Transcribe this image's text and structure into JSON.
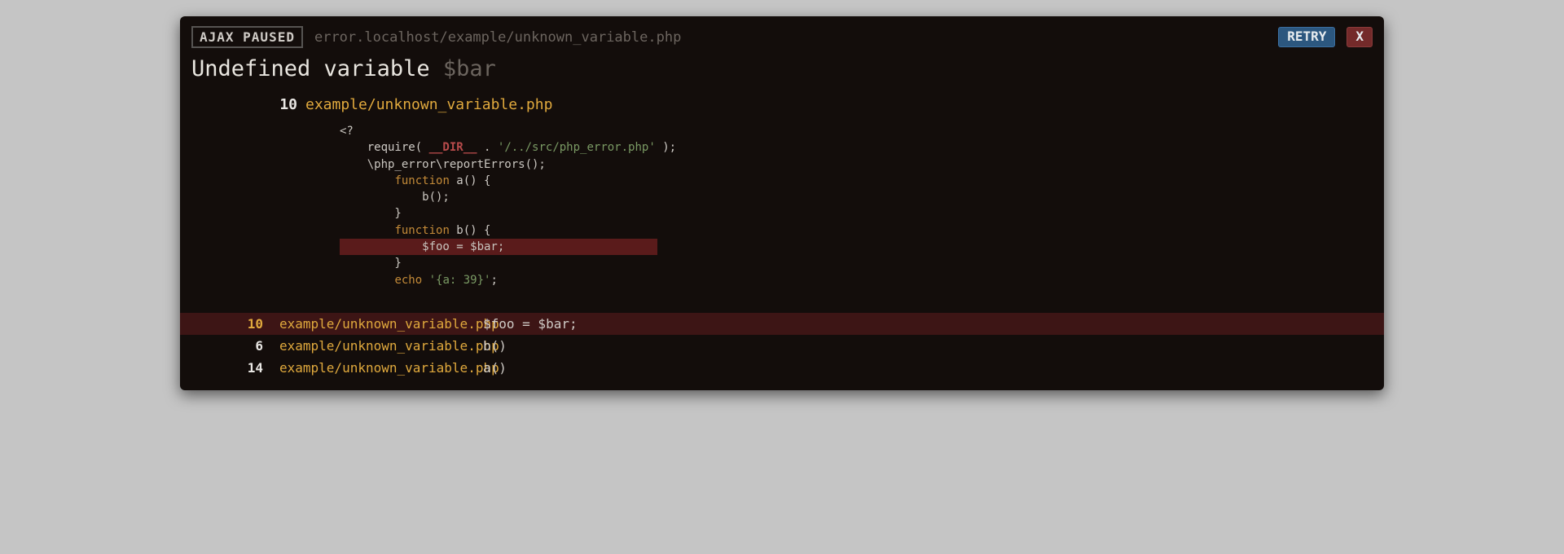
{
  "topbar": {
    "badge": "AJAX PAUSED",
    "url": "error.localhost/example/unknown_variable.php",
    "retry_label": "RETRY",
    "close_label": "X"
  },
  "error": {
    "title_prefix": "Undefined variable ",
    "title_variable": "$bar"
  },
  "file_header": {
    "line": "10",
    "path": "example/unknown_variable.php"
  },
  "code": {
    "l1": "<?",
    "l2a": "    require( ",
    "l2b": "__DIR__",
    "l2c": " . ",
    "l2d": "'/../src/php_error.php'",
    "l2e": " );",
    "l3": "    \\php_error\\reportErrors();",
    "l4": "",
    "l5a": "        ",
    "l5b": "function",
    "l5c": " a() {",
    "l6": "            b();",
    "l7": "        }",
    "l8": "",
    "l9a": "        ",
    "l9b": "function",
    "l9c": " b() {",
    "l10": "            $foo = $bar;",
    "l11": "        }",
    "l12": "",
    "l13a": "        ",
    "l13b": "echo",
    "l13c": " ",
    "l13d": "'{a: 39}'",
    "l13e": ";"
  },
  "stack": [
    {
      "line": "10",
      "file": "example/unknown_variable.php",
      "snippet": "$foo = $bar;",
      "active": true
    },
    {
      "line": "6",
      "file": "example/unknown_variable.php",
      "snippet": "b()",
      "active": false
    },
    {
      "line": "14",
      "file": "example/unknown_variable.php",
      "snippet": "a()",
      "active": false
    }
  ]
}
